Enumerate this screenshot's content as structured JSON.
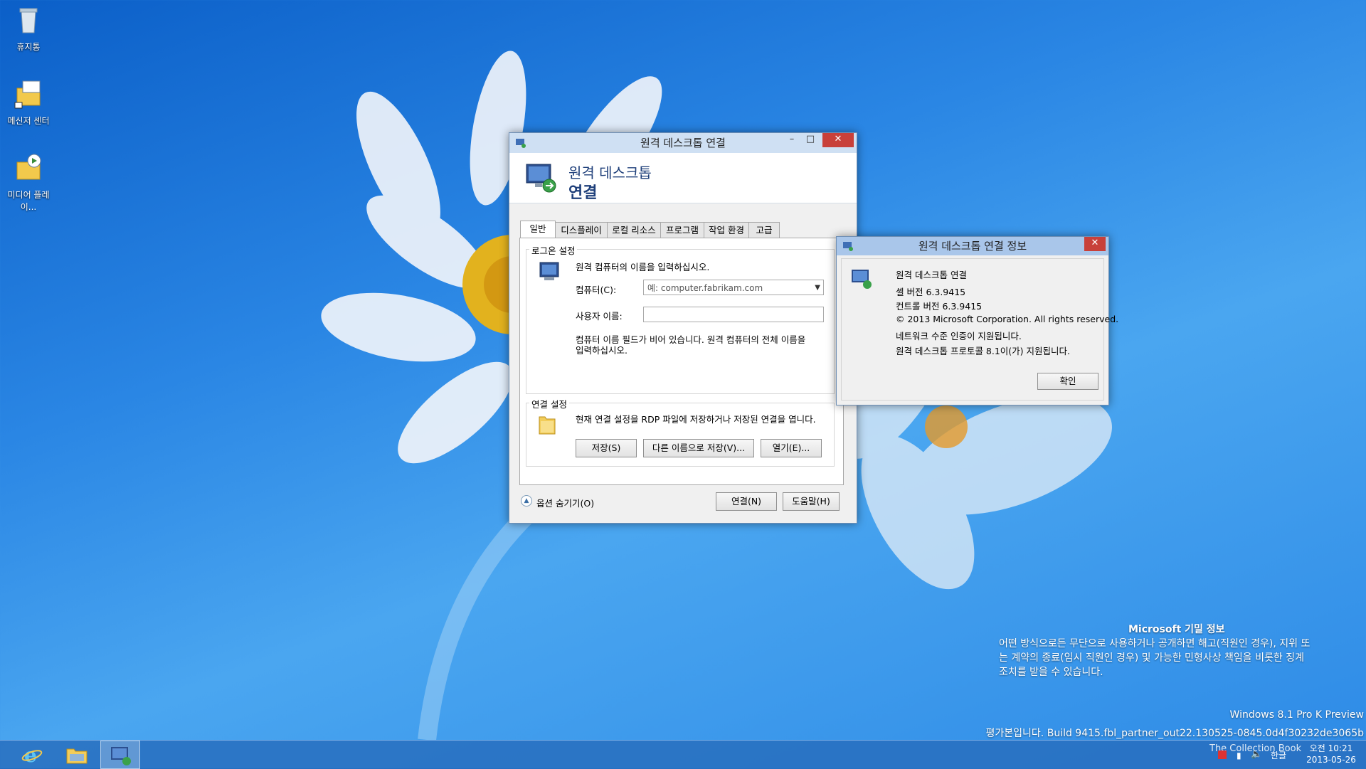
{
  "desktop": {
    "icons": [
      {
        "label": "휴지통",
        "icon": "recycle-bin-icon"
      },
      {
        "label": "메신저 센터",
        "icon": "messenger-center-icon"
      },
      {
        "label": "미디어 플레이...",
        "icon": "media-player-icon"
      }
    ]
  },
  "rdp_window": {
    "title": "원격 데스크톱 연결",
    "header_line1": "원격 데스크톱",
    "header_line2": "연결",
    "tabs": [
      "일반",
      "디스플레이",
      "로컬 리소스",
      "프로그램",
      "작업 환경",
      "고급"
    ],
    "logon_group_title": "로그온 설정",
    "logon_prompt": "원격 컴퓨터의 이름을 입력하십시오.",
    "computer_label": "컴퓨터(C):",
    "computer_placeholder": "예: computer.fabrikam.com",
    "username_label": "사용자 이름:",
    "username_value": "",
    "hint_line1": "컴퓨터 이름 필드가 비어 있습니다. 원격 컴퓨터의 전체 이름을",
    "hint_line2": "입력하십시오.",
    "connection_group_title": "연결 설정",
    "connection_desc": "현재 연결 설정을 RDP 파일에 저장하거나 저장된 연결을 엽니다.",
    "save_label": "저장(S)",
    "save_as_label": "다른 이름으로 저장(V)...",
    "open_label": "열기(E)...",
    "hide_options_label": "옵션 숨기기(O)",
    "connect_label": "연결(N)",
    "help_label": "도움말(H)"
  },
  "about_window": {
    "title": "원격 데스크톱 연결 정보",
    "lines": [
      "원격 데스크톱 연결",
      "셸 버전 6.3.9415",
      "컨트롤 버전 6.3.9415",
      "© 2013 Microsoft Corporation. All rights reserved.",
      "네트워크 수준 인증이 지원됩니다.",
      "원격 데스크톱 프로토콜 8.1이(가) 지원됩니다."
    ],
    "ok_label": "확인"
  },
  "watermark": {
    "title": "Microsoft 기밀 정보",
    "line1": "어떤 방식으로든 무단으로 사용하거나 공개하면 해고(직원인 경우), 지위 또",
    "line2": "는 계약의 종료(임시 직원인 경우) 및 가능한 민형사상 책임을 비롯한 징계",
    "line3": "조치를 받을 수 있습니다.",
    "edition": "Windows 8.1 Pro K Preview",
    "build": "평가본입니다. Build 9415.fbl_partner_out22.130525-0845.0d4f30232de3065b"
  },
  "taskbar": {
    "items": [
      "internet-explorer-icon",
      "file-explorer-icon",
      "remote-desktop-icon"
    ],
    "ime": "한글",
    "time": "오전 10:21",
    "date": "2013-05-26",
    "overlay_text": "The Collection Book"
  },
  "colors": {
    "accent": "#1a5ea8",
    "close": "#c8403a",
    "header_title": "#1e3f7a"
  }
}
